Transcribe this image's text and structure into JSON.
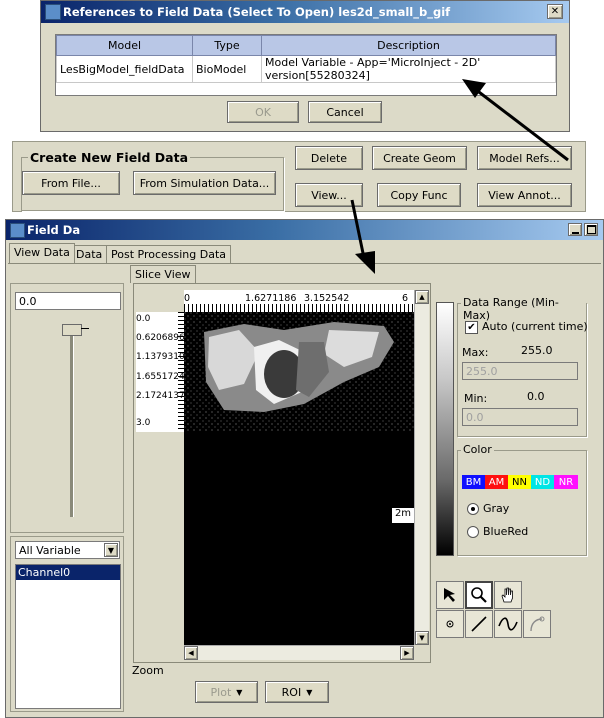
{
  "refs_dialog": {
    "title": "References to Field Data (Select To Open) les2d_small_b_gif",
    "columns": [
      "Model",
      "Type",
      "Description"
    ],
    "rows": [
      {
        "model": "LesBigModel_fieldData",
        "type": "BioModel",
        "description": "Model Variable - App='MicroInject - 2D' version[55280324]"
      }
    ],
    "ok_label": "OK",
    "cancel_label": "Cancel",
    "close_glyph": "✕"
  },
  "field_data_panel": {
    "group_title": "Create New Field Data",
    "from_file_label": "From File...",
    "from_sim_label": "From Simulation Data...",
    "delete_label": "Delete",
    "create_geom_label": "Create Geom",
    "model_refs_label": "Model Refs...",
    "view_label": "View...",
    "copy_func_label": "Copy Func",
    "view_annot_label": "View Annot..."
  },
  "viewer": {
    "title": "Field Da",
    "tabs": [
      "View Data",
      "Data",
      "Post Processing Data"
    ],
    "slice_value": "0.0",
    "variable_select": "All Variable",
    "variables": [
      "Channel0"
    ],
    "subtab": "Slice View",
    "top_ticks": [
      "0",
      "1.6271186",
      "3.152542",
      "6"
    ],
    "left_ticks": [
      "0.0",
      "0.62068965",
      "1.1379310",
      "1.6551724",
      "2.1724137",
      "3.0"
    ],
    "zoom_label": "Zoom",
    "tooltip": "2m",
    "plot_label": "Plot",
    "roi_label": "ROI",
    "data_range": {
      "title": "Data Range (Min-Max)",
      "auto_label": "Auto (current time)",
      "max_label": "Max:",
      "max_value": "255.0",
      "max_field": "255.0",
      "min_label": "Min:",
      "min_value": "0.0",
      "min_field": "0.0"
    },
    "color": {
      "title": "Color",
      "swatches": [
        {
          "label": "BM",
          "bg": "#1010ff",
          "fg": "#ffffff"
        },
        {
          "label": "AM",
          "bg": "#ff1010",
          "fg": "#ffffff"
        },
        {
          "label": "NN",
          "bg": "#ffff00",
          "fg": "#000000"
        },
        {
          "label": "ND",
          "bg": "#00e5e5",
          "fg": "#ffffff"
        },
        {
          "label": "NR",
          "bg": "#ff10ff",
          "fg": "#ffffff"
        }
      ],
      "gray_label": "Gray",
      "bluered_label": "BlueRed"
    }
  }
}
